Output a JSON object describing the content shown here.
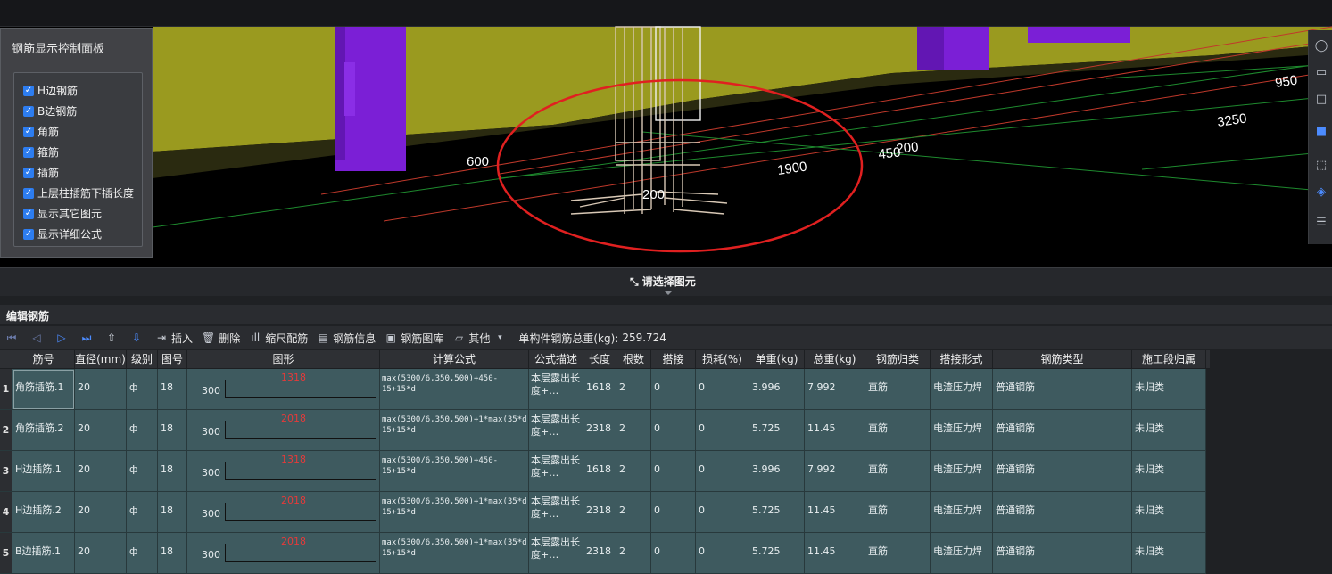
{
  "viewport": {
    "labels": {
      "d600": "600",
      "d1900": "1900",
      "d200": "200",
      "d4500": "450",
      "d200b": "200",
      "d3250": "3250",
      "d950": "950"
    }
  },
  "panel": {
    "title": "钢筋显示控制面板",
    "items": [
      {
        "label": "H边钢筋"
      },
      {
        "label": "B边钢筋"
      },
      {
        "label": "角筋"
      },
      {
        "label": "箍筋"
      },
      {
        "label": "插筋"
      },
      {
        "label": "上层柱插筋下插长度"
      },
      {
        "label": "显示其它图元"
      },
      {
        "label": "显示详细公式"
      }
    ]
  },
  "selection": {
    "prompt": "请选择图元"
  },
  "editor": {
    "title": "编辑钢筋"
  },
  "toolbar": {
    "insert": "插入",
    "delete": "删除",
    "scale": "缩尺配筋",
    "info": "钢筋信息",
    "library": "钢筋图库",
    "other": "其他",
    "total_label": "单构件钢筋总重(kg):",
    "total_value": "259.724"
  },
  "table": {
    "headers": [
      "筋号",
      "直径(mm)",
      "级别",
      "图号",
      "图形",
      "计算公式",
      "公式描述",
      "长度",
      "根数",
      "搭接",
      "损耗(%)",
      "单重(kg)",
      "总重(kg)",
      "钢筋归类",
      "搭接形式",
      "钢筋类型",
      "施工段归属"
    ],
    "rows": [
      {
        "num": "1",
        "name": "角筋插筋.1",
        "dia": "20",
        "grade": "ф",
        "fig": "18",
        "s300": "300",
        "slen": "1318",
        "formula": "max(5300/6,350,500)+450-15+15*d",
        "desc": "本层露出长度+…",
        "len": "1618",
        "count": "2",
        "lap": "0",
        "loss": "0",
        "unit": "3.996",
        "total": "7.992",
        "cat": "直筋",
        "lapform": "电渣压力焊",
        "type": "普通钢筋",
        "seg": "未归类"
      },
      {
        "num": "2",
        "name": "角筋插筋.2",
        "dia": "20",
        "grade": "ф",
        "fig": "18",
        "s300": "300",
        "slen": "2018",
        "formula": "max(5300/6,350,500)+1*max(35*d,500)+450-15+15*d",
        "desc": "本层露出长度+…",
        "len": "2318",
        "count": "2",
        "lap": "0",
        "loss": "0",
        "unit": "5.725",
        "total": "11.45",
        "cat": "直筋",
        "lapform": "电渣压力焊",
        "type": "普通钢筋",
        "seg": "未归类"
      },
      {
        "num": "3",
        "name": "H边插筋.1",
        "dia": "20",
        "grade": "ф",
        "fig": "18",
        "s300": "300",
        "slen": "1318",
        "formula": "max(5300/6,350,500)+450-15+15*d",
        "desc": "本层露出长度+…",
        "len": "1618",
        "count": "2",
        "lap": "0",
        "loss": "0",
        "unit": "3.996",
        "total": "7.992",
        "cat": "直筋",
        "lapform": "电渣压力焊",
        "type": "普通钢筋",
        "seg": "未归类"
      },
      {
        "num": "4",
        "name": "H边插筋.2",
        "dia": "20",
        "grade": "ф",
        "fig": "18",
        "s300": "300",
        "slen": "2018",
        "formula": "max(5300/6,350,500)+1*max(35*d,500)+450-15+15*d",
        "desc": "本层露出长度+…",
        "len": "2318",
        "count": "2",
        "lap": "0",
        "loss": "0",
        "unit": "5.725",
        "total": "11.45",
        "cat": "直筋",
        "lapform": "电渣压力焊",
        "type": "普通钢筋",
        "seg": "未归类"
      },
      {
        "num": "5",
        "name": "B边插筋.1",
        "dia": "20",
        "grade": "ф",
        "fig": "18",
        "s300": "300",
        "slen": "2018",
        "formula": "max(5300/6,350,500)+1*max(35*d,500)+450-15+15*d",
        "desc": "本层露出长度+…",
        "len": "2318",
        "count": "2",
        "lap": "0",
        "loss": "0",
        "unit": "5.725",
        "total": "11.45",
        "cat": "直筋",
        "lapform": "电渣压力焊",
        "type": "普通钢筋",
        "seg": "未归类"
      }
    ]
  }
}
